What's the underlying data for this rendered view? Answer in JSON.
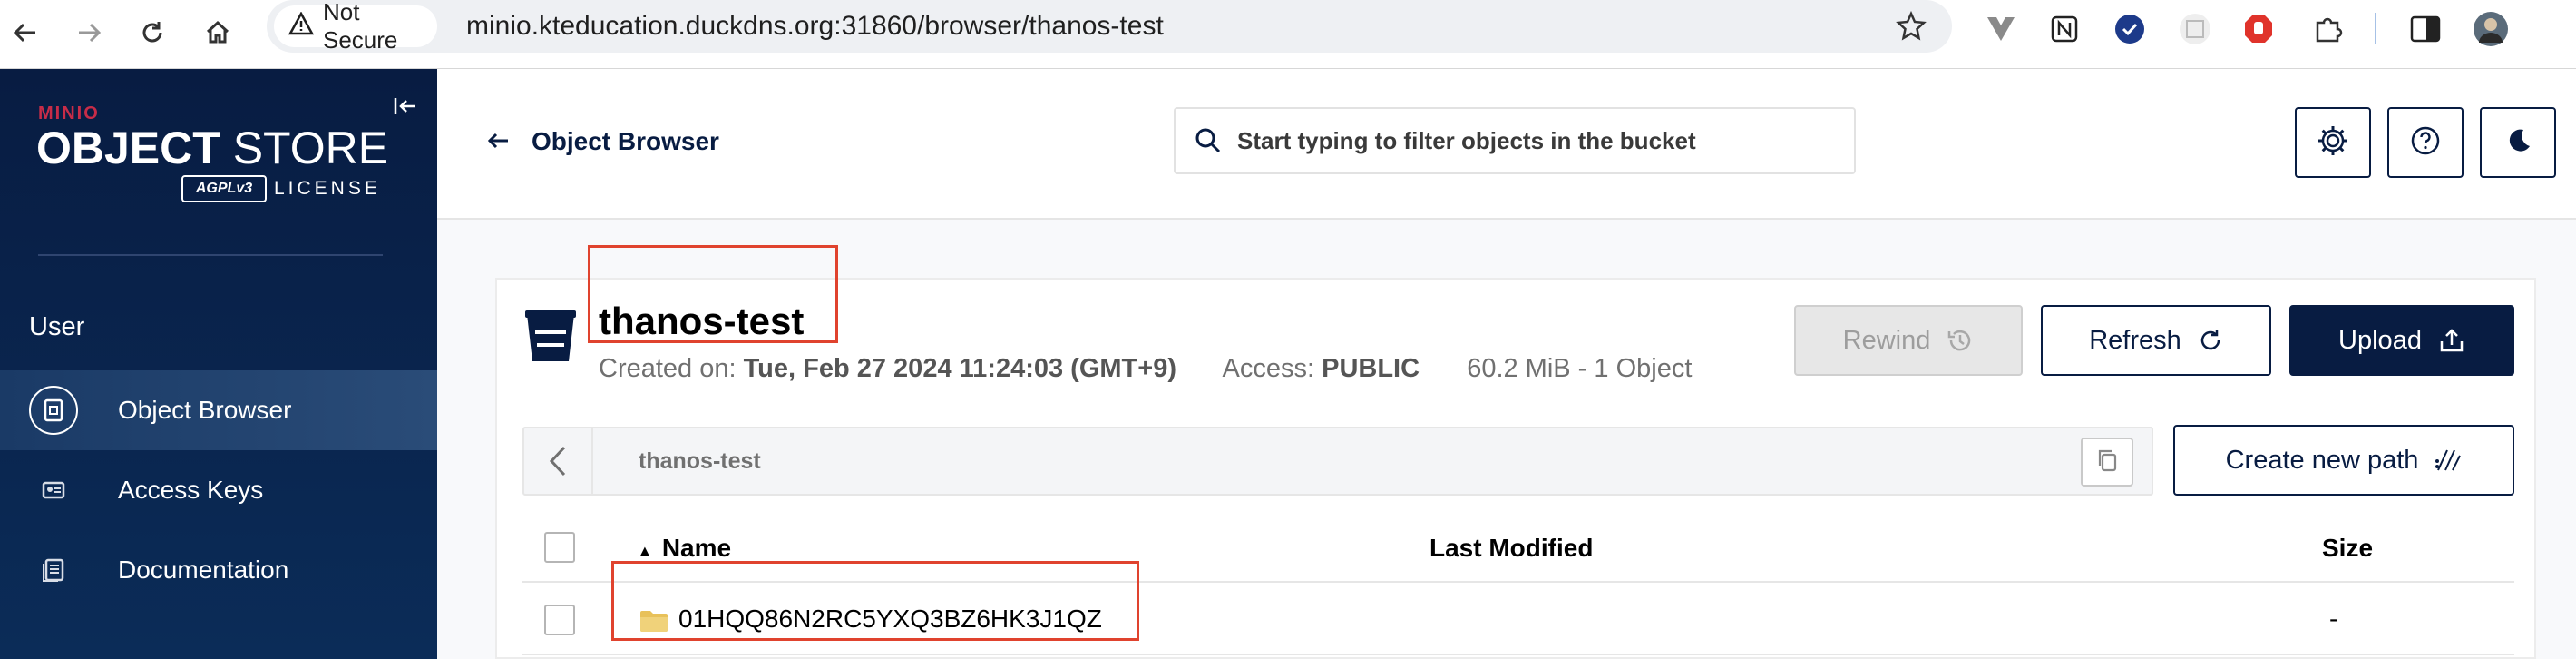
{
  "browser": {
    "security_label": "Not Secure",
    "url": "minio.kteducation.duckdns.org:31860/browser/thanos-test"
  },
  "sidebar": {
    "brand_top": "MINIO",
    "brand_main_bold": "OBJECT",
    "brand_main_light": " STORE",
    "brand_agpl": "AGPLv3",
    "brand_license": "LICENSE",
    "section_label": "User",
    "items": [
      {
        "label": "Object Browser",
        "icon": "object-browser-icon",
        "active": true
      },
      {
        "label": "Access Keys",
        "icon": "access-keys-icon",
        "active": false
      },
      {
        "label": "Documentation",
        "icon": "documentation-icon",
        "active": false
      }
    ]
  },
  "header": {
    "back_label": "Object Browser",
    "search_placeholder": "Start typing to filter objects in the bucket"
  },
  "bucket": {
    "name": "thanos-test",
    "created_label": "Created on:",
    "created_value": "Tue, Feb 27 2024 11:24:03 (GMT+9)",
    "access_label": "Access:",
    "access_value": "PUBLIC",
    "usage": "60.2 MiB - 1 Object"
  },
  "actions": {
    "rewind": "Rewind",
    "refresh": "Refresh",
    "upload": "Upload",
    "create_path": "Create new path"
  },
  "path": {
    "current": "thanos-test"
  },
  "table": {
    "headers": {
      "name": "Name",
      "modified": "Last Modified",
      "size": "Size"
    },
    "sort_indicator": "▲",
    "rows": [
      {
        "name": "01HQQ86N2RC5YXQ3BZ6HK3J1QZ",
        "modified": "",
        "size": "-",
        "type": "folder"
      }
    ]
  },
  "colors": {
    "navy": "#081c42",
    "highlight_red": "#e0432e",
    "folder": "#e8c15a"
  }
}
